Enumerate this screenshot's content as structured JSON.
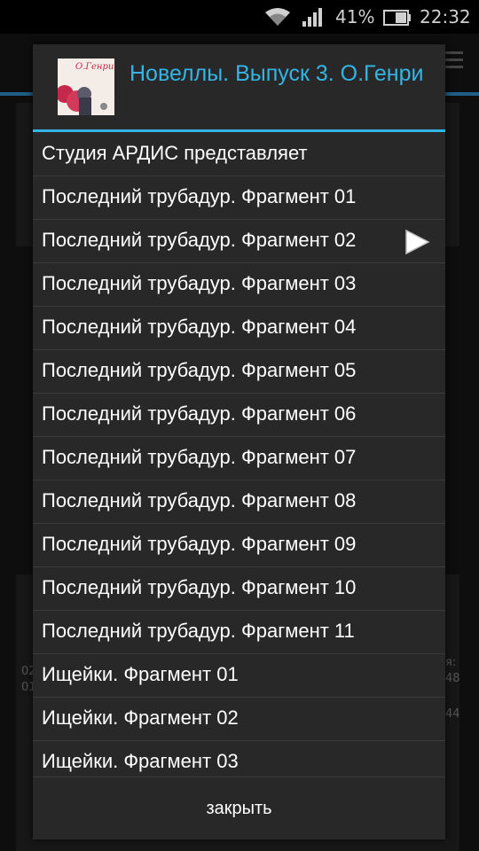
{
  "status_bar": {
    "battery_percent": "41%",
    "time": "22:32",
    "icons": [
      "wifi-icon",
      "signal-icon",
      "battery-icon"
    ]
  },
  "background": {
    "left_text_1": "02",
    "left_text_2": "01",
    "right_text_1": "я:",
    "right_text_2": "48",
    "right_text_3": "44"
  },
  "dialog": {
    "title": "Новеллы. Выпуск 3. О.Генри",
    "cover_text": "О.Генри",
    "accent_color": "#34b5e5",
    "items": [
      {
        "label": "Студия АРДИС представляет",
        "playing": false
      },
      {
        "label": "Последний трубадур. Фрагмент 01",
        "playing": false
      },
      {
        "label": "Последний трубадур. Фрагмент 02",
        "playing": true
      },
      {
        "label": "Последний трубадур. Фрагмент 03",
        "playing": false
      },
      {
        "label": "Последний трубадур. Фрагмент 04",
        "playing": false
      },
      {
        "label": "Последний трубадур. Фрагмент 05",
        "playing": false
      },
      {
        "label": "Последний трубадур. Фрагмент 06",
        "playing": false
      },
      {
        "label": "Последний трубадур. Фрагмент 07",
        "playing": false
      },
      {
        "label": "Последний трубадур. Фрагмент 08",
        "playing": false
      },
      {
        "label": "Последний трубадур. Фрагмент 09",
        "playing": false
      },
      {
        "label": "Последний трубадур. Фрагмент 10",
        "playing": false
      },
      {
        "label": "Последний трубадур. Фрагмент 11",
        "playing": false
      },
      {
        "label": "Ищейки. Фрагмент 01",
        "playing": false
      },
      {
        "label": "Ищейки. Фрагмент 02",
        "playing": false
      },
      {
        "label": "Ищейки. Фрагмент 03",
        "playing": false
      }
    ],
    "close_label": "закрыть"
  }
}
